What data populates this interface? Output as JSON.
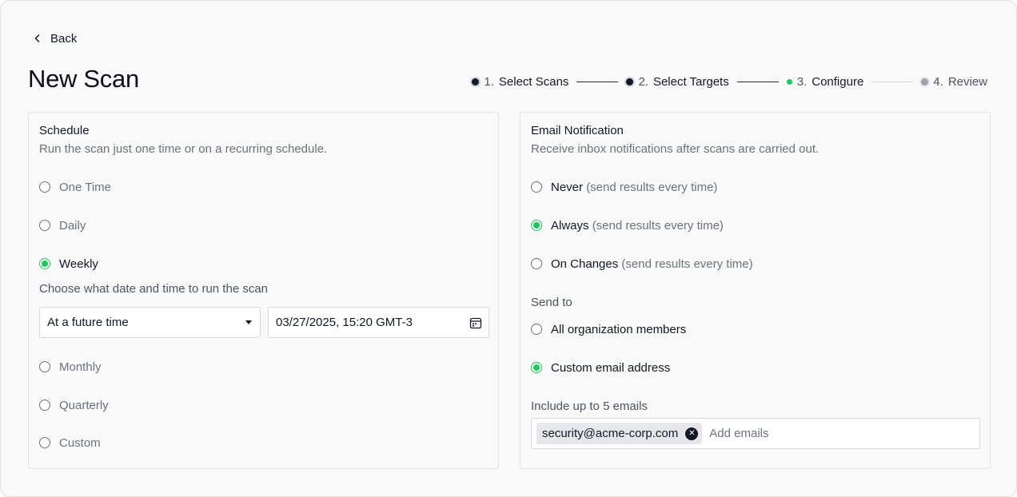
{
  "header": {
    "back_label": "Back",
    "title": "New Scan"
  },
  "stepper": {
    "steps": [
      {
        "num": "1.",
        "label": "Select Scans",
        "state": "done"
      },
      {
        "num": "2.",
        "label": "Select Targets",
        "state": "done"
      },
      {
        "num": "3.",
        "label": "Configure",
        "state": "active"
      },
      {
        "num": "4.",
        "label": "Review",
        "state": "pending"
      }
    ]
  },
  "schedule": {
    "title": "Schedule",
    "description": "Run the scan just one time or on a recurring schedule.",
    "options": [
      {
        "label": "One Time",
        "checked": false
      },
      {
        "label": "Daily",
        "checked": false
      },
      {
        "label": "Weekly",
        "checked": true
      },
      {
        "label": "Monthly",
        "checked": false
      },
      {
        "label": "Quarterly",
        "checked": false
      },
      {
        "label": "Custom",
        "checked": false
      }
    ],
    "weekly_prompt": "Choose what date and time to run the scan",
    "timing_select_value": "At a future time",
    "datetime_value": "03/27/2025, 15:20 GMT-3"
  },
  "email": {
    "title": "Email Notification",
    "description": "Receive inbox notifications after scans are carried out.",
    "options": [
      {
        "label": "Never",
        "hint": "(send results every time)",
        "checked": false
      },
      {
        "label": "Always",
        "hint": "(send results every time)",
        "checked": true
      },
      {
        "label": "On Changes",
        "hint": "(send results every time)",
        "checked": false
      }
    ],
    "send_to_label": "Send to",
    "recipients": [
      {
        "label": "All organization members",
        "checked": false
      },
      {
        "label": "Custom email address",
        "checked": true
      }
    ],
    "include_label": "Include up to 5 emails",
    "chip_email": "security@acme-corp.com",
    "input_placeholder": "Add emails"
  },
  "colors": {
    "accent": "#22c55e",
    "text": "#111827",
    "muted": "#6b7280",
    "border": "#e3e3e3"
  }
}
